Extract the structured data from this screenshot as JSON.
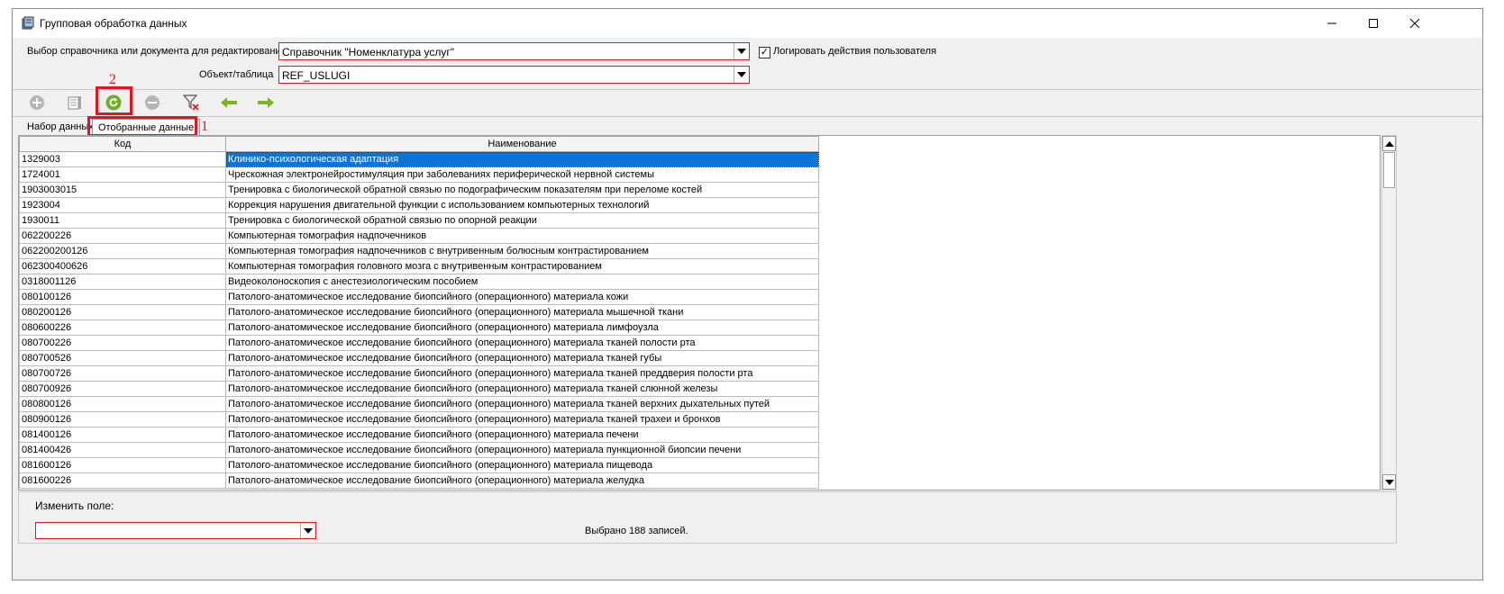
{
  "window": {
    "title": "Групповая обработка данных"
  },
  "form": {
    "source_label": "Выбор справочника или документа для редактирования",
    "source_value": "Справочник \"Номенклатура услуг\"",
    "log_label": "Логировать действия пользователя",
    "log_checked": "✓",
    "object_label": "Объект/таблица",
    "object_value": "REF_USLUGI"
  },
  "toolbar": [
    "add-icon",
    "card-icon",
    "refresh-icon",
    "remove-icon",
    "filter-clear-icon",
    "arrow-left-icon",
    "arrow-right-icon"
  ],
  "tabs": [
    {
      "label": "Набор данных",
      "active": false
    },
    {
      "label": "Отобранные данные",
      "active": true
    }
  ],
  "annotations": {
    "tab_marker": "1",
    "refresh_marker": "2",
    "color": "#e0171f"
  },
  "grid": {
    "columns": [
      "Код",
      "Наименование"
    ],
    "rows": [
      [
        "1329003",
        "Клинико-психологическая адаптация"
      ],
      [
        "1724001",
        "Чрескожная электронейростимуляция при заболеваниях периферической нервной системы"
      ],
      [
        "1903003015",
        "Тренировка с биологической обратной связью по подографическим показателям при переломе костей"
      ],
      [
        "1923004",
        "Коррекция нарушения двигательной функции с использованием компьютерных технологий"
      ],
      [
        "1930011",
        "Тренировка с биологической обратной связью по опорной реакции"
      ],
      [
        "062200226",
        "Компьютерная томография надпочечников"
      ],
      [
        "062200200126",
        "Компьютерная томография надпочечников с внутривенным болюсным контрастированием"
      ],
      [
        "062300400626",
        "Компьютерная томография головного мозга с внутривенным контрастированием"
      ],
      [
        "0318001126",
        "Видеоколоноскопия с анестезиологическим пособием"
      ],
      [
        "080100126",
        "Патолого-анатомическое исследование биопсийного (операционного) материала кожи"
      ],
      [
        "080200126",
        "Патолого-анатомическое исследование биопсийного (операционного) материала мышечной ткани"
      ],
      [
        "080600226",
        "Патолого-анатомическое исследование биопсийного (операционного) материала лимфоузла"
      ],
      [
        "080700226",
        "Патолого-анатомическое исследование биопсийного (операционного) материала тканей полости рта"
      ],
      [
        "080700526",
        "Патолого-анатомическое исследование биопсийного (операционного) материала тканей губы"
      ],
      [
        "080700726",
        "Патолого-анатомическое исследование биопсийного (операционного) материала тканей преддверия полости рта"
      ],
      [
        "080700926",
        "Патолого-анатомическое исследование биопсийного (операционного) материала тканей слюнной железы"
      ],
      [
        "080800126",
        "Патолого-анатомическое исследование биопсийного (операционного) материала тканей верхних дыхательных путей"
      ],
      [
        "080900126",
        "Патолого-анатомическое исследование биопсийного (операционного) материала тканей трахеи и бронхов"
      ],
      [
        "081400126",
        "Патолого-анатомическое исследование биопсийного (операционного) материала печени"
      ],
      [
        "081400426",
        "Патолого-анатомическое исследование биопсийного (операционного) материала пункционной биопсии печени"
      ],
      [
        "081600126",
        "Патолого-анатомическое исследование биопсийного (операционного) материала пищевода"
      ],
      [
        "081600226",
        "Патолого-анатомическое исследование биопсийного (операционного) материала желудка"
      ]
    ]
  },
  "bottom": {
    "change_field_label": "Изменить поле:",
    "change_field_value": "",
    "status": "Выбрано 188 записей."
  }
}
